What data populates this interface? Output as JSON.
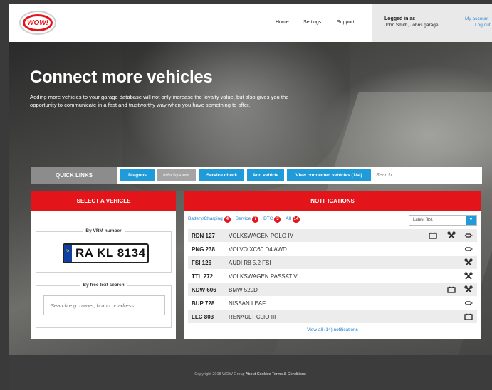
{
  "header": {
    "logo_text": "WOW!",
    "nav": {
      "home": "Home",
      "settings": "Settings",
      "support": "Support"
    },
    "login": {
      "title": "Logged in as",
      "user": "John Smith, Johns garage",
      "account_link": "My account",
      "logout_link": "Log out"
    }
  },
  "hero": {
    "title": "Connect more vehicles",
    "text": "Adding more vehicles to your garage database will not only increase the loyalty value, but also gives you the opportunity to communicate in a fast and trustworthy way when you have something to offer."
  },
  "quick_links": {
    "label": "QUICK LINKS",
    "buttons": [
      {
        "label": "Diagnos",
        "enabled": true
      },
      {
        "label": "Info System",
        "enabled": false
      },
      {
        "label": "Service check",
        "enabled": true
      },
      {
        "label": "Add vehicle",
        "enabled": true
      },
      {
        "label": "View connected vehicles (184)",
        "enabled": true
      }
    ],
    "search_placeholder": "Search"
  },
  "select_vehicle": {
    "title": "SELECT A VEHICLE",
    "vrm_legend": "By VRM number",
    "plate": "RA KL 8134",
    "free_legend": "By free text search",
    "free_placeholder": "Search e.g. owner, brand or adress"
  },
  "notifications": {
    "title": "NOTIFICATIONS",
    "filters": [
      {
        "label": "Battery/Charging",
        "count": "4"
      },
      {
        "label": "Service",
        "count": "7"
      },
      {
        "label": "DTC",
        "count": "3"
      },
      {
        "label": "All",
        "count": "14"
      }
    ],
    "sort": "Latest first",
    "rows": [
      {
        "reg": "RDN 127",
        "model": "VOLKSWAGEN POLO IV",
        "icons": [
          "battery-icon",
          "wrench-icon",
          "engine-icon"
        ]
      },
      {
        "reg": "PNG 238",
        "model": "VOLVO XC60 D4 AWD",
        "icons": [
          "engine-icon"
        ]
      },
      {
        "reg": "FSI 126",
        "model": "AUDI R8 5.2 FSI",
        "icons": [
          "wrench-icon"
        ]
      },
      {
        "reg": "TTL 272",
        "model": "VOLKSWAGEN PASSAT V",
        "icons": [
          "wrench-icon"
        ]
      },
      {
        "reg": "KDW 606",
        "model": "BMW 520D",
        "icons": [
          "battery-icon",
          "wrench-icon"
        ]
      },
      {
        "reg": "BUP 728",
        "model": "NISSAN LEAF",
        "icons": [
          "engine-icon"
        ]
      },
      {
        "reg": "LLC 803",
        "model": "RENAULT CLIO III",
        "icons": [
          "battery-icon"
        ]
      }
    ],
    "view_all": "- View all (14) notifications -"
  },
  "footer": {
    "copyright": "Copyright 2018 WOW Group",
    "cookies": "About Cookies",
    "terms": "Terms & Conditions"
  },
  "colors": {
    "accent_red": "#e4141b",
    "accent_blue": "#1f9bd9",
    "link_blue": "#1f7fd0"
  }
}
